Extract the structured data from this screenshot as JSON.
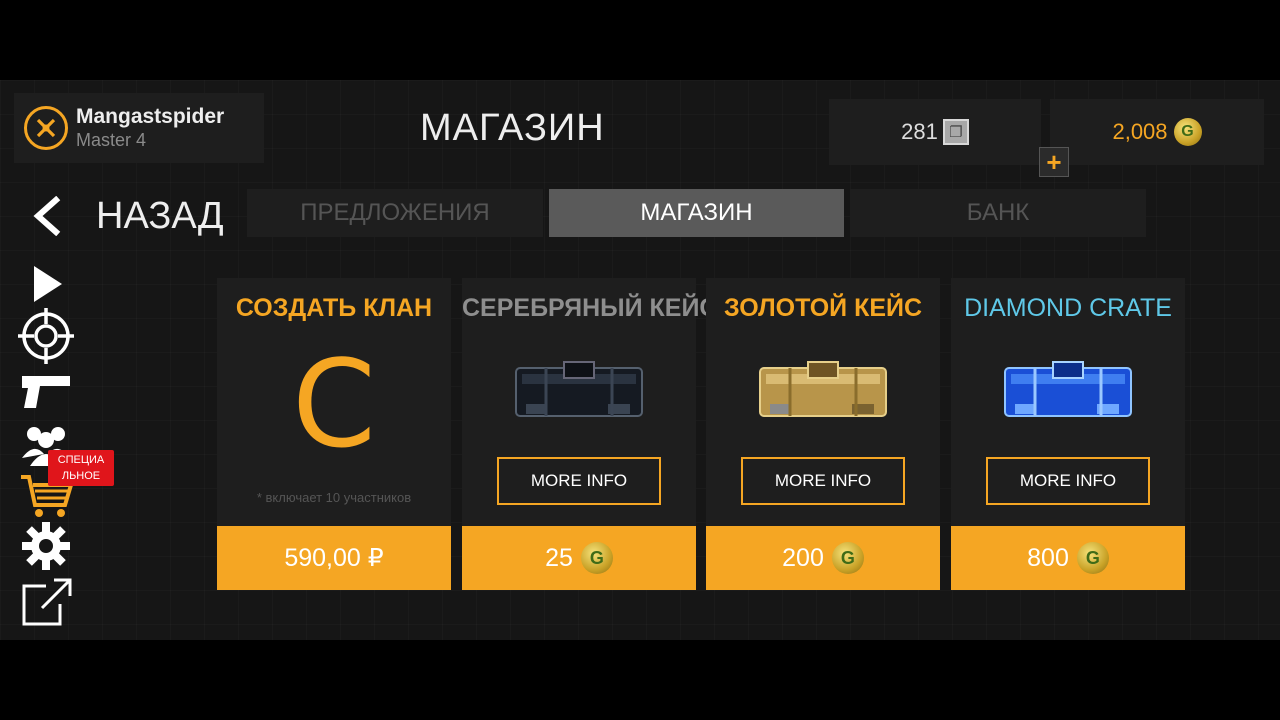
{
  "player": {
    "name": "Mangastspider",
    "rank": "Master 4"
  },
  "page_title": "МАГАЗИН",
  "currency": {
    "silver": "281",
    "gold": "2,008",
    "silver_icon": "silver-token-icon",
    "gold_icon": "gold-coin-icon",
    "add_label": "+"
  },
  "back_label": "НАЗАД",
  "tabs": [
    {
      "label": "ПРЕДЛОЖЕНИЯ",
      "active": false
    },
    {
      "label": "МАГАЗИН",
      "active": true
    },
    {
      "label": "БАНК",
      "active": false
    }
  ],
  "sidenav": {
    "items": [
      "play-icon",
      "crosshair-icon",
      "pistol-icon",
      "clan-users-icon",
      "shop-cart-icon",
      "gear-icon",
      "external-link-icon"
    ],
    "badge": "СПЕЦИА\nЛЬНОЕ"
  },
  "cards": [
    {
      "title": "СОЗДАТЬ КЛАН",
      "title_color": "#f5a623",
      "logo_letter": "C",
      "note": "* включает 10 участников",
      "price": "590,00 ₽"
    },
    {
      "title": "СЕРЕБРЯНЫЙ КЕЙС",
      "title_color": "#8e8e8e",
      "button": "MORE INFO",
      "price": "25",
      "crate": "silver-crate"
    },
    {
      "title": "ЗОЛОТОЙ КЕЙС",
      "title_color": "#f5a623",
      "button": "MORE INFO",
      "price": "200",
      "crate": "gold-crate"
    },
    {
      "title": "DIAMOND CRATE",
      "title_color": "#5fc8e8",
      "button": "MORE INFO",
      "price": "800",
      "crate": "diamond-crate"
    }
  ],
  "colors": {
    "accent": "#f5a623",
    "panel": "#1e1e1e",
    "badge": "#e0151b"
  }
}
